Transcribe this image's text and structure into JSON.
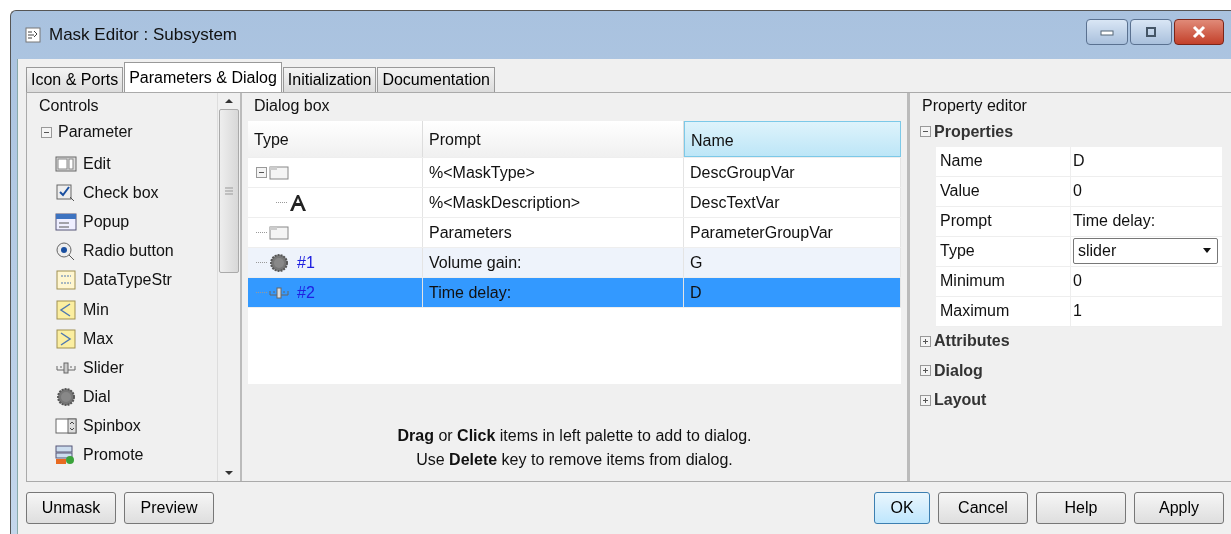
{
  "window": {
    "title": "Mask Editor : Subsystem"
  },
  "tabs": [
    {
      "label": "Icon & Ports",
      "selected": false
    },
    {
      "label": "Parameters & Dialog",
      "selected": true
    },
    {
      "label": "Initialization",
      "selected": false
    },
    {
      "label": "Documentation",
      "selected": false
    }
  ],
  "controls": {
    "title": "Controls",
    "group": {
      "label": "Parameter",
      "expanded": true,
      "items": [
        {
          "kind": "edit",
          "label": "Edit"
        },
        {
          "kind": "checkbox",
          "label": "Check box"
        },
        {
          "kind": "popup",
          "label": "Popup"
        },
        {
          "kind": "radio",
          "label": "Radio button"
        },
        {
          "kind": "datatype",
          "label": "DataTypeStr"
        },
        {
          "kind": "min",
          "label": "Min"
        },
        {
          "kind": "max",
          "label": "Max"
        },
        {
          "kind": "slider",
          "label": "Slider"
        },
        {
          "kind": "dial",
          "label": "Dial"
        },
        {
          "kind": "spinbox",
          "label": "Spinbox"
        },
        {
          "kind": "promote",
          "label": "Promote"
        }
      ]
    }
  },
  "dialog_box": {
    "title": "Dialog box",
    "columns": [
      {
        "label": "Type",
        "selected": false
      },
      {
        "label": "Prompt",
        "selected": false
      },
      {
        "label": "Name",
        "selected": true
      }
    ],
    "rows": [
      {
        "kind": "group",
        "expanded": true,
        "prompt": "%<MaskType>",
        "name": "DescGroupVar",
        "selected": false,
        "children": [
          {
            "kind": "text",
            "prompt": "%<MaskDescription>",
            "name": "DescTextVar",
            "selected": false
          }
        ]
      },
      {
        "kind": "group",
        "prompt": "Parameters",
        "name": "ParameterGroupVar",
        "selected": false
      },
      {
        "kind": "dial",
        "index": "#1",
        "prompt": "Volume gain:",
        "name": "G",
        "selected": false
      },
      {
        "kind": "slider",
        "index": "#2",
        "prompt": "Time delay:",
        "name": "D",
        "selected": true
      }
    ],
    "hint": [
      "**Drag** or **Click** items in left palette to add to dialog.",
      "Use **Delete** key to remove items from dialog."
    ]
  },
  "property_editor": {
    "title": "Property editor",
    "sections": [
      {
        "label": "Properties",
        "expanded": true,
        "rows": [
          {
            "kind": "text",
            "label": "Name",
            "value": "D"
          },
          {
            "kind": "text",
            "label": "Value",
            "value": "0"
          },
          {
            "kind": "text",
            "label": "Prompt",
            "value": "Time delay:"
          },
          {
            "kind": "select",
            "label": "Type",
            "value": "slider"
          },
          {
            "kind": "text",
            "label": "Minimum",
            "value": "0"
          },
          {
            "kind": "text",
            "label": "Maximum",
            "value": "1"
          }
        ]
      },
      {
        "label": "Attributes",
        "expanded": false
      },
      {
        "label": "Dialog",
        "expanded": false
      },
      {
        "label": "Layout",
        "expanded": false
      }
    ]
  },
  "buttons_left": [
    "Unmask",
    "Preview"
  ],
  "buttons_right": [
    {
      "label": "OK",
      "default": true
    },
    {
      "label": "Cancel",
      "default": false
    },
    {
      "label": "Help",
      "default": false
    },
    {
      "label": "Apply",
      "default": false
    }
  ]
}
